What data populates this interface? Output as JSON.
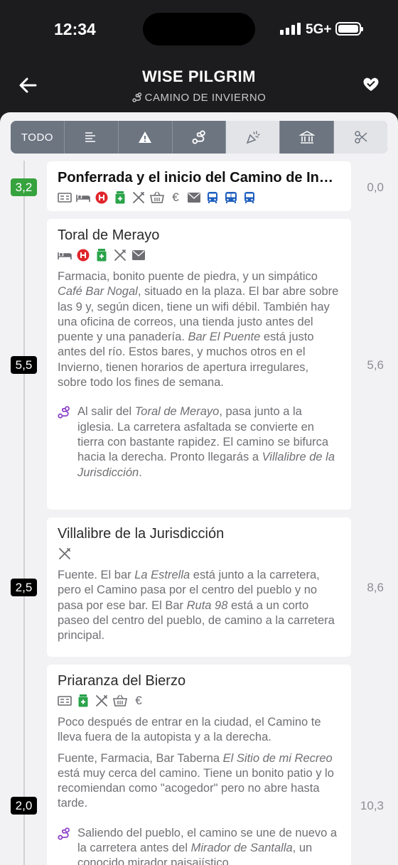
{
  "status_bar": {
    "time": "12:34",
    "network": "5G+"
  },
  "header": {
    "title": "WISE PILGRIM",
    "subtitle": "CAMINO DE INVIERNO"
  },
  "filters": {
    "all_label": "TODO"
  },
  "stages": [
    {
      "segment": "3,2",
      "name": "Ponferrada y el inicio del Camino de Invierno",
      "km": "0,0",
      "icons": [
        "hostel-icon",
        "bed-icon",
        "hospital-icon",
        "pharmacy-icon",
        "restaurant-icon",
        "shop-icon",
        "atm-icon",
        "post-icon",
        "bus-icon",
        "bus-icon",
        "bus-icon"
      ]
    },
    {
      "segment": "5,5",
      "name": "Toral de Merayo",
      "km": "5,6",
      "icons": [
        "bed-icon",
        "hospital-icon",
        "pharmacy-icon",
        "restaurant-icon",
        "post-icon"
      ],
      "desc": {
        "p1": "Farmacia, bonito puente de piedra, y un simpático ",
        "i1": "Café Bar Nogal",
        "p2": ", situado en la plaza. El bar abre sobre las 9 y, según dicen, tiene un wifi débil. También hay una oficina de correos, una tienda justo antes del puente y una panadería. ",
        "i2": "Bar El Puente",
        "p3": " está justo antes del río. Estos bares, y muchos otros en el Invierno, tienen horarios de apertura irregulares, sobre todo los fines de semana."
      },
      "directions": {
        "p1": "Al salir del ",
        "i1": "Toral de Merayo",
        "p2": ", pasa junto a la iglesia. La carretera asfaltada se convierte en tierra con bastante rapidez. El camino se bifurca hacia la derecha. Pronto llegarás a ",
        "i2": "Villalibre de la Jurisdicción",
        "p3": "."
      }
    },
    {
      "segment": "2,5",
      "name": "Villalibre de la Jurisdicción",
      "km": "8,6",
      "icons": [
        "restaurant-icon"
      ],
      "desc": {
        "p1": "Fuente. El bar ",
        "i1": "La Estrella",
        "p2": " está junto a la carretera, pero el Camino pasa por el centro del pueblo y no pasa por ese bar. El Bar ",
        "i2": "Ruta 98",
        "p3": " está a un corto paseo del centro del pueblo, de camino a la carretera principal."
      }
    },
    {
      "segment": "2,0",
      "name": "Priaranza del Bierzo",
      "km": "10,3",
      "icons": [
        "hostel-icon",
        "pharmacy-icon",
        "restaurant-icon",
        "shop-icon",
        "atm-icon"
      ],
      "desc_intro": "Poco después de entrar en la ciudad, el Camino te lleva fuera de la autopista y a la derecha.",
      "desc": {
        "p1": "Fuente, Farmacia, Bar Taberna ",
        "i1": "El Sitio de mi Recreo",
        "p2": " está muy cerca del camino. Tiene un bonito patio y lo recomiendan como \"acogedor\" pero no abre hasta tarde."
      },
      "directions": {
        "p1": "Saliendo del pueblo, el camino se une de nuevo a la carretera antes del ",
        "i1": "Mirador de Santalla",
        "p2": ", un conocido mirador paisajístico."
      }
    }
  ],
  "colors": {
    "accent_green": "#36a33e",
    "hospital_red": "#e0262b",
    "pharmacy_green": "#2aa34a",
    "bus_blue": "#1f5fbf",
    "route_purple": "#8e44c9"
  }
}
